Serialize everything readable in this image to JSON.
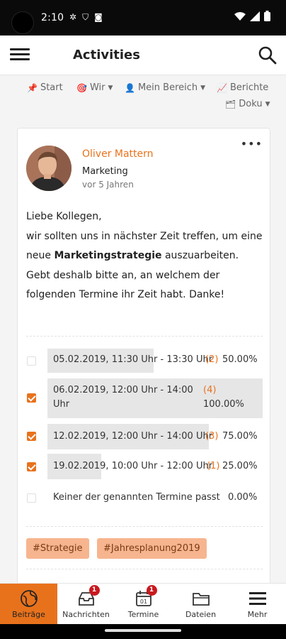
{
  "status_bar": {
    "time": "2:10"
  },
  "app_bar": {
    "title": "Activities"
  },
  "subnav": {
    "items": [
      {
        "label": "Start",
        "icon": "pin-icon",
        "dropdown": false
      },
      {
        "label": "Wir",
        "icon": "target-icon",
        "dropdown": true
      },
      {
        "label": "Mein Bereich",
        "icon": "person-icon",
        "dropdown": true
      },
      {
        "label": "Berichte",
        "icon": "chart-icon",
        "dropdown": false
      },
      {
        "label": "Doku",
        "icon": "folder-icon",
        "dropdown": true
      }
    ]
  },
  "post": {
    "author": "Oliver Mattern",
    "department": "Marketing",
    "time": "vor 5 Jahren",
    "text": {
      "before": "Liebe Kollegen,\nwir sollten uns in nächster Zeit treffen, um eine neue ",
      "bold": "Marketingstrategie",
      "after": " auszuarbeiten. Gebt deshalb bitte an, an welchem der folgenden Termine ihr Zeit habt. Danke!"
    },
    "poll": [
      {
        "label": "05.02.2019, 11:30 Uhr - 13:30 Uhr",
        "count": "(2)",
        "percent": "50.00%",
        "checked": false,
        "fraction": 0.5
      },
      {
        "label": "06.02.2019, 12:00 Uhr - 14:00 Uhr",
        "count": "(4)",
        "percent": "100.00%",
        "checked": true,
        "fraction": 1.0
      },
      {
        "label": "12.02.2019, 12:00 Uhr - 14:00 Uhr",
        "count": "(3)",
        "percent": "75.00%",
        "checked": true,
        "fraction": 0.75
      },
      {
        "label": "19.02.2019, 10:00 Uhr - 12:00 Uhr",
        "count": "(1)",
        "percent": "25.00%",
        "checked": true,
        "fraction": 0.25
      },
      {
        "label": "Keiner der genannten Termine passt",
        "count": "",
        "percent": "0.00%",
        "checked": false,
        "fraction": 0
      }
    ],
    "tags": [
      "#Strategie",
      "#Jahresplanung2019"
    ]
  },
  "bottom_nav": {
    "tabs": [
      {
        "label": "Beiträge",
        "icon": "globe-icon",
        "active": true,
        "badge": ""
      },
      {
        "label": "Nachrichten",
        "icon": "inbox-icon",
        "active": false,
        "badge": "1"
      },
      {
        "label": "Termine",
        "icon": "calendar-icon",
        "active": false,
        "badge": "1"
      },
      {
        "label": "Dateien",
        "icon": "folder-icon",
        "active": false,
        "badge": ""
      },
      {
        "label": "Mehr",
        "icon": "hamburger-icon",
        "active": false,
        "badge": ""
      }
    ]
  },
  "colors": {
    "accent": "#e8721c",
    "tag_bg": "#f7b58f",
    "badge": "#c8191f"
  }
}
